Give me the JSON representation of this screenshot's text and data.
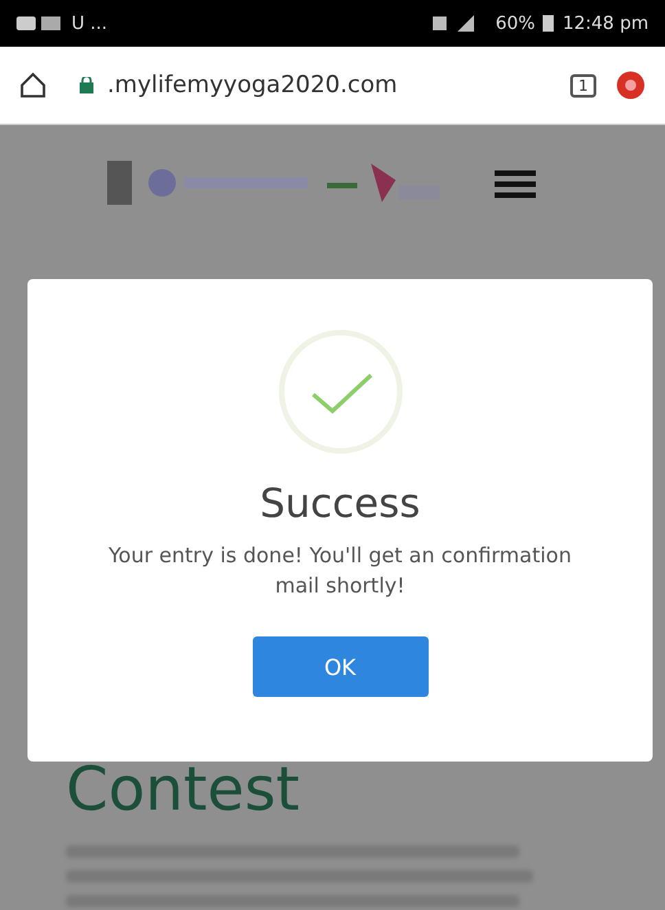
{
  "status_bar": {
    "left_text": "U ...",
    "battery": "60%",
    "time": "12:48 pm"
  },
  "browser": {
    "url": ".mylifemyyoga2020.com",
    "tab_count": "1"
  },
  "page": {
    "heading": "Contest"
  },
  "dialog": {
    "title": "Success",
    "message": "Your entry is done! You'll get an confirmation mail shortly!",
    "button": "OK"
  }
}
